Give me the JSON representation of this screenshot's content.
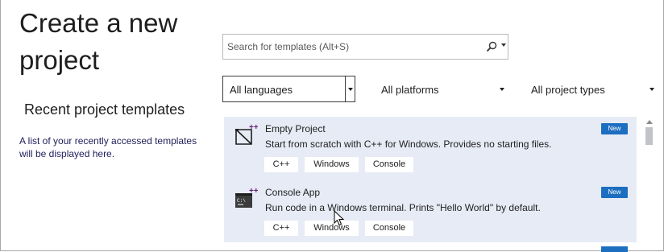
{
  "page": {
    "title": "Create a new project"
  },
  "recent": {
    "title": "Recent project templates",
    "description": "A list of your recently accessed templates will be displayed here."
  },
  "search": {
    "placeholder": "Search for templates (Alt+S)",
    "value": "",
    "icon": "search-icon"
  },
  "filters": {
    "language": "All languages",
    "platform": "All platforms",
    "project_type": "All project types"
  },
  "templates": [
    {
      "name": "Empty Project",
      "description": "Start from scratch with C++ for Windows. Provides no starting files.",
      "badge": "New",
      "icon": "empty-project-icon",
      "tags": [
        "C++",
        "Windows",
        "Console"
      ]
    },
    {
      "name": "Console App",
      "description": "Run code in a Windows terminal. Prints \"Hello World\" by default.",
      "badge": "New",
      "icon": "console-app-icon",
      "tags": [
        "C++",
        "Windows",
        "Console"
      ]
    }
  ],
  "colors": {
    "selected_panel": "#e6ebf5",
    "badge": "#1c6ec1",
    "accent_purple": "#68217a"
  }
}
